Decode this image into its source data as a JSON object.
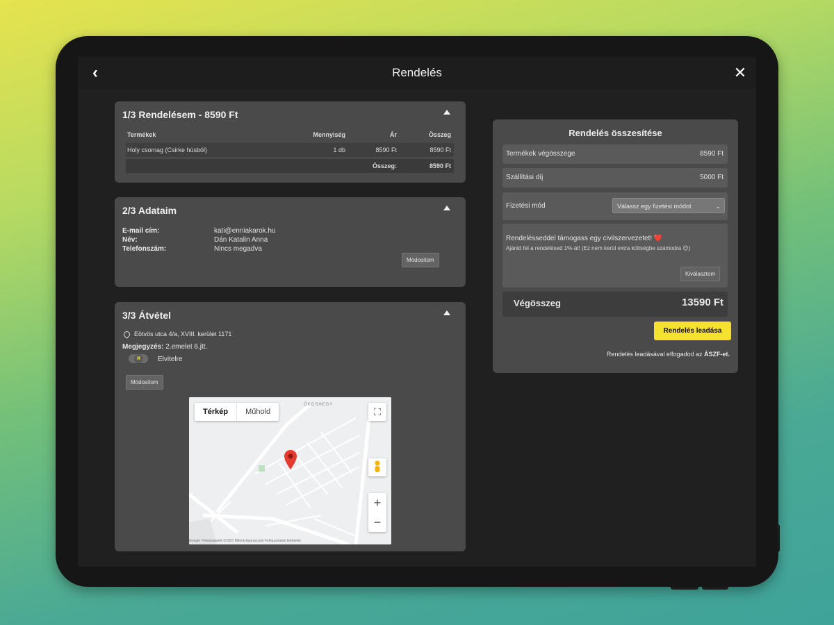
{
  "header": {
    "title": "Rendelés",
    "back_icon": "‹",
    "close_icon": "✕"
  },
  "order": {
    "title": "1/3 Rendelésem - 8590 Ft",
    "columns": [
      "Termékek",
      "Mennyiség",
      "Ár",
      "Összeg"
    ],
    "rows": [
      {
        "name": "Holy csomag (Csirke húsból)",
        "qty": "1 db",
        "price": "8590 Ft",
        "sum": "8590 Ft"
      }
    ],
    "total_label": "Összeg:",
    "total_value": "8590 Ft"
  },
  "details": {
    "title": "2/3 Adataim",
    "email_label": "E-mail cím:",
    "email_value": "kati@enniakarok.hu",
    "name_label": "Név:",
    "name_value": "Dán Katalin Anna",
    "phone_label": "Telefonszám:",
    "phone_value": "Nincs megadva",
    "edit_label": "Módosítom"
  },
  "pickup": {
    "title": "3/3 Átvétel",
    "address": "Eötvös utca 4/a, XVIII. kerület 1171",
    "note_label": "Megjegyzés:",
    "note_value": "2.emelet 6.jtt.",
    "takeaway_label": "Elvitelre",
    "edit_label": "Módosítom",
    "map": {
      "tab_map": "Térkép",
      "tab_satellite": "Műhold",
      "area_label": "ŐKOSHEGY",
      "footer": "Google   Térképadatok ©2023   Billentyűparancsok   Felhasználási feltételek"
    }
  },
  "summary": {
    "title": "Rendelés összesítése",
    "products_label": "Termékek végösszege",
    "products_value": "8590 Ft",
    "shipping_label": "Szállítási díj",
    "shipping_value": "5000 Ft",
    "payment_label": "Fizetési mód",
    "payment_placeholder": "Válassz egy fizetési módot",
    "charity_title": "Rendelésseddel támogass egy civilszervezetet! ❤️",
    "charity_text": "Ajánld fel a rendelésed 1%-át! (Ez nem kerül extra költségbe számodra 😊)",
    "charity_button": "Kiválasztom",
    "total_label": "Végösszeg",
    "total_value": "13590 Ft",
    "order_button": "Rendelés leadása",
    "terms_text": "Rendelés leadásával elfogadod az",
    "terms_link": "ÁSZF-et."
  },
  "colors": {
    "accent": "#f5e230",
    "card": "#4a4a4a",
    "screen": "#202020"
  }
}
